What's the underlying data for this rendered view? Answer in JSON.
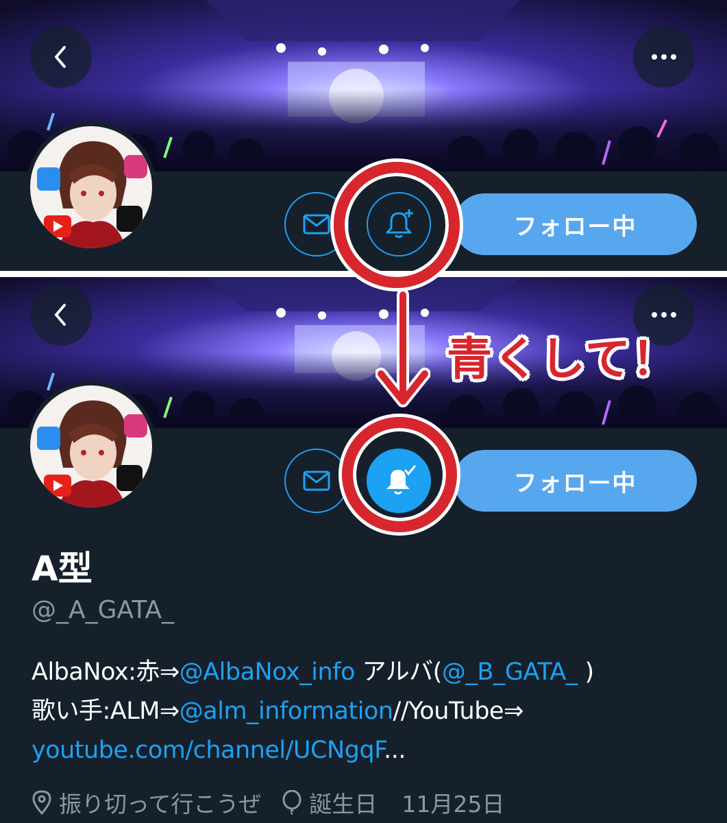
{
  "profile": {
    "display_name": "A型",
    "handle": "@_A_GATA_",
    "follow_label": "フォロー中",
    "bio": {
      "line1_prefix": "AlbaNox:赤⇒",
      "line1_link1": "@AlbaNox_info",
      "line1_mid": " アルバ(",
      "line1_link2": "@_B_GATA_",
      "line1_suffix": " )",
      "line2_prefix": "歌い手:ALM⇒",
      "line2_link": "@alm_information",
      "line2_suffix": "//YouTube⇒",
      "line3_link": "youtube.com/channel/UCNgqF",
      "line3_suffix": "..."
    },
    "location": "振り切って行こうぜ",
    "birthday_label": "誕生日",
    "birthday_value": "11月25日"
  },
  "annotation": {
    "text": "青くして！",
    "color": "#d8262f"
  },
  "icons": {
    "back": "chevron-left-icon",
    "more": "more-dots-icon",
    "mail": "mail-icon",
    "bell_add": "bell-plus-icon",
    "bell_on": "bell-check-icon",
    "location": "location-pin-icon",
    "birthday": "balloon-icon"
  },
  "colors": {
    "background": "#15202b",
    "accent": "#1da1f2",
    "follow_button": "#57a7ef",
    "muted_text": "#8899a6"
  }
}
